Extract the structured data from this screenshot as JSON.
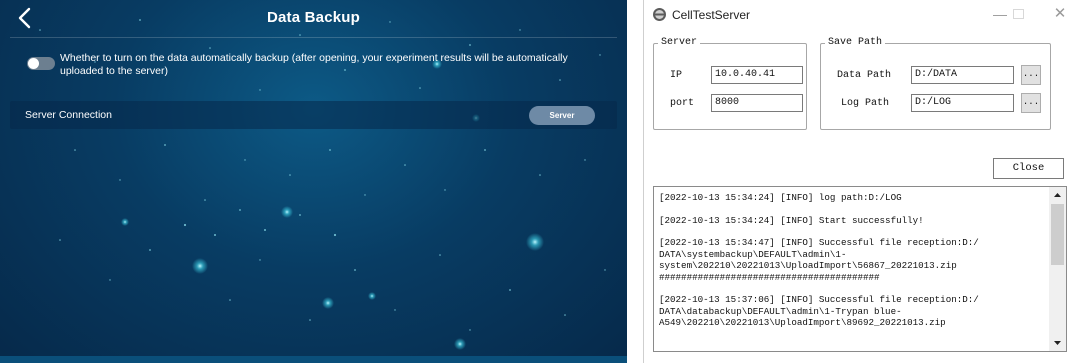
{
  "app": {
    "title": "Data Backup",
    "auto_backup_text": "Whether to turn on the data automatically backup (after opening, your experiment results will be automatically uploaded to the server)",
    "auto_backup_enabled": false,
    "server_connection_label": "Server Connection",
    "server_button_label": "Server",
    "icons": {
      "back": "chevron-left-icon"
    },
    "colors": {
      "background": "#083c63",
      "accent": "#6e8aa6"
    }
  },
  "window": {
    "title": "CellTestServer",
    "server_group": {
      "legend": "Server",
      "ip_label": "IP",
      "ip_value": "10.0.40.41",
      "port_label": "port",
      "port_value": "8000"
    },
    "save_path_group": {
      "legend": "Save Path",
      "data_path_label": "Data Path",
      "data_path_value": "D:/DATA",
      "log_path_label": "Log Path",
      "log_path_value": "D:/LOG",
      "browse_label": "..."
    },
    "close_button_label": "Close",
    "log_entries": [
      "[2022-10-13 15:34:24] [INFO] log path:D:/LOG",
      "[2022-10-13 15:34:24] [INFO] Start successfully!",
      "[2022-10-13 15:34:47] [INFO] Successful file reception:D:/\nDATA\\systembackup\\DEFAULT\\admin\\1-\nsystem\\202210\\20221013\\UploadImport\\56867_20221013.zip\n########################################",
      "[2022-10-13 15:37:06] [INFO] Successful file reception:D:/\nDATA\\databackup\\DEFAULT\\admin\\1-Trypan blue-\nA549\\202210\\20221013\\UploadImport\\89692_20221013.zip"
    ],
    "icons": {
      "app": "server-app-icon",
      "minimize": "minimize-icon",
      "maximize": "maximize-icon",
      "close": "close-icon"
    }
  }
}
